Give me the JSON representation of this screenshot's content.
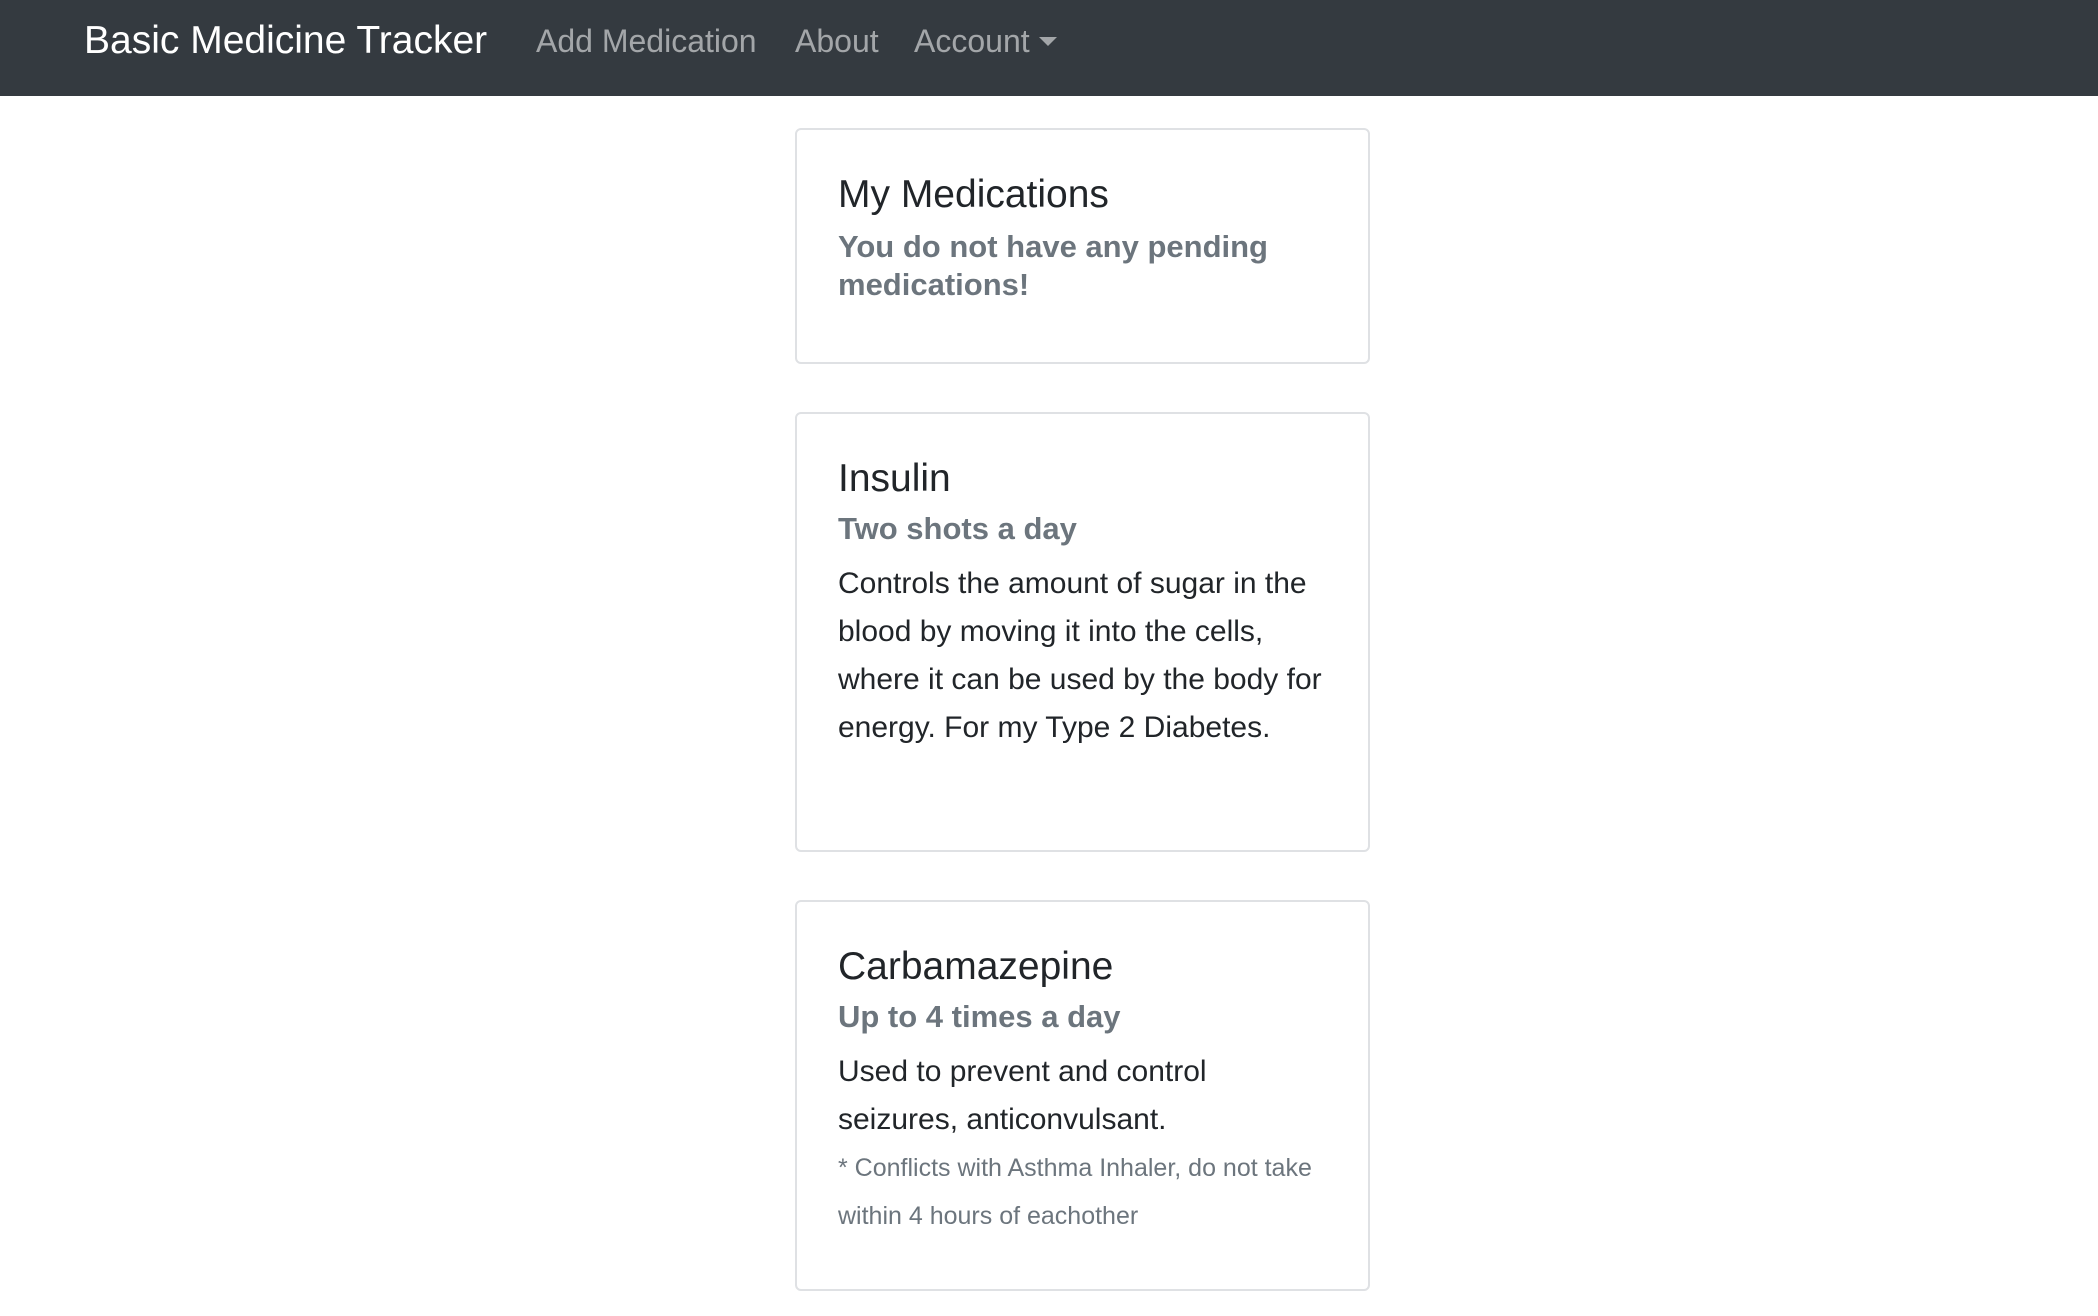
{
  "navbar": {
    "brand": "Basic Medicine Tracker",
    "links": {
      "add_medication": "Add Medication",
      "about": "About",
      "account": "Account"
    }
  },
  "summary_card": {
    "title": "My Medications",
    "subtitle": "You do not have any pending medications!"
  },
  "medications": [
    {
      "name": "Insulin",
      "frequency": "Two shots a day",
      "description": "Controls the amount of sugar in the blood by moving it into the cells, where it can be used by the body for energy. For my Type 2 Diabetes."
    },
    {
      "name": "Carbamazepine",
      "frequency": "Up to 4 times a day",
      "description": "Used to prevent and control seizures, anticonvulsant.",
      "note": "* Conflicts with Asthma Inhaler, do not take within 4 hours of eachother"
    }
  ]
}
